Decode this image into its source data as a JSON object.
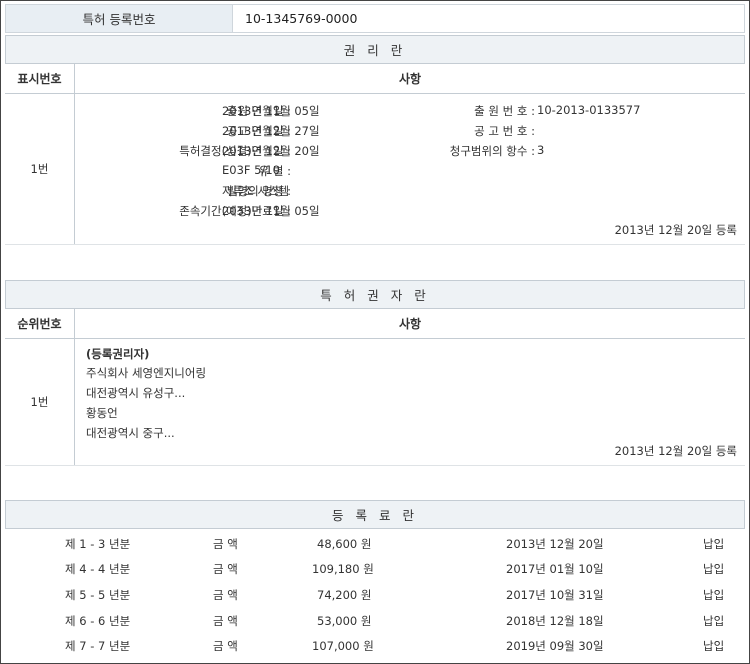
{
  "registration": {
    "label": "특허 등록번호",
    "number": "10-1345769-0000"
  },
  "rights": {
    "title": "권 리 란",
    "col_no": "표시번호",
    "col_item": "사항",
    "row_no": "1번",
    "left_fields": [
      {
        "key": "출원 연월일 :",
        "value": "2013년 11월 05일"
      },
      {
        "key": "공고 연월일 :",
        "value": "2013년 12월 27일"
      },
      {
        "key": "특허결정(심결)연월일 :",
        "value": "2013년 12월 20일"
      },
      {
        "key": "유 별 :",
        "value": "E03F 5/10"
      },
      {
        "key": "발명의 명칭 :",
        "value": "저류조 시스템"
      },
      {
        "key": "존속기간(예정)만료일 :",
        "value": "2033년 11월 05일"
      }
    ],
    "right_fields": [
      {
        "key": "출 원 번 호 :",
        "value": "10-2013-0133577"
      },
      {
        "key": "공 고 번 호 :",
        "value": ""
      },
      {
        "key": "청구범위의 항수 :",
        "value": "3"
      }
    ],
    "reg_date": "2013년 12월 20일 등록"
  },
  "holders": {
    "title": "특 허 권 자 란",
    "col_no": "순위번호",
    "col_item": "사항",
    "row_no": "1번",
    "heading": "(등록권리자)",
    "lines": [
      "주식회사 세영엔지니어링",
      "대전광역시 유성구...",
      "황동언",
      "대전광역시 중구..."
    ],
    "reg_date": "2013년 12월 20일 등록"
  },
  "fees": {
    "title": "등 록 료 란",
    "rows": [
      {
        "period": "제 1 - 3 년분",
        "amount_label": "금 액",
        "amount": "48,600 원",
        "date": "2013년 12월 20일",
        "status": "납입"
      },
      {
        "period": "제 4 - 4 년분",
        "amount_label": "금 액",
        "amount": "109,180 원",
        "date": "2017년 01월 10일",
        "status": "납입"
      },
      {
        "period": "제 5 - 5 년분",
        "amount_label": "금 액",
        "amount": "74,200 원",
        "date": "2017년 10월 31일",
        "status": "납입"
      },
      {
        "period": "제 6 - 6 년분",
        "amount_label": "금 액",
        "amount": "53,000 원",
        "date": "2018년 12월 18일",
        "status": "납입"
      },
      {
        "period": "제 7 - 7 년분",
        "amount_label": "금 액",
        "amount": "107,000 원",
        "date": "2019년 09월 30일",
        "status": "납입"
      }
    ]
  }
}
